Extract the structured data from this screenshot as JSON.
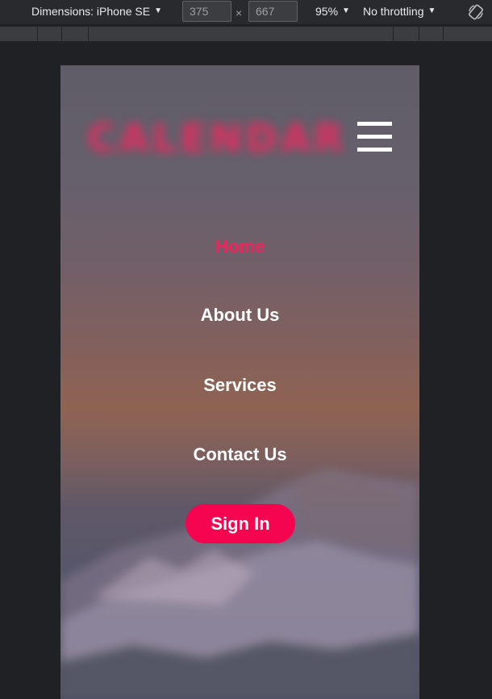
{
  "devtools": {
    "dimensions_label": "Dimensions: iPhone SE",
    "width_value": "375",
    "height_value": "667",
    "times_symbol": "×",
    "zoom_label": "95%",
    "throttling_label": "No throttling",
    "caret_icon": "caret-down",
    "rotate_icon": "rotate-icon"
  },
  "site": {
    "logo_text": "CALENDAR",
    "menu_icon": "hamburger-menu-icon",
    "accent_color": "#f0245c",
    "nav": [
      {
        "label": "Home",
        "active": true
      },
      {
        "label": "About Us",
        "active": false
      },
      {
        "label": "Services",
        "active": false
      },
      {
        "label": "Contact Us",
        "active": false
      }
    ],
    "signin_label": "Sign In"
  }
}
